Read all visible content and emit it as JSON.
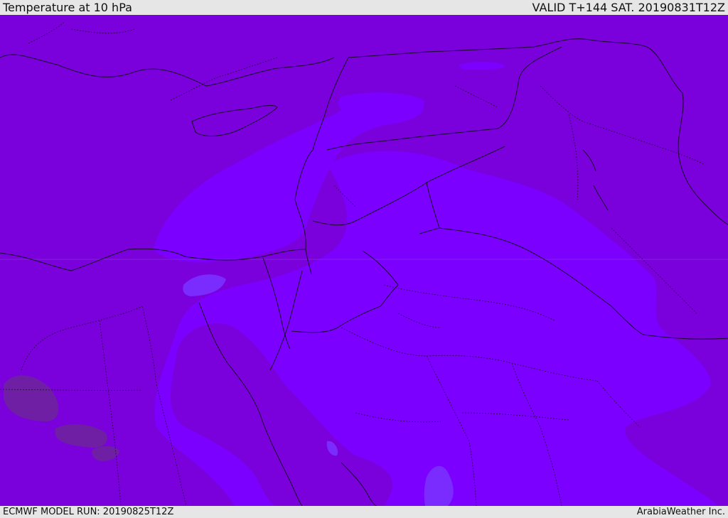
{
  "header": {
    "title": "Temperature at 10 hPa",
    "valid": "VALID T+144 SAT. 20190831T12Z"
  },
  "footer": {
    "model_run": "ECMWF MODEL RUN: 20190825T12Z",
    "credit": "ArabiaWeather Inc."
  },
  "colors": {
    "background_field": "#7a00dc",
    "warm_field": "#7b00ff",
    "cold_patch": "#6e1fa4",
    "warm_core": "#7a2cff",
    "borders": "#1a0a2a",
    "top_bar": "#e6e6e6",
    "bottom_bar": "#e6e6e6"
  }
}
